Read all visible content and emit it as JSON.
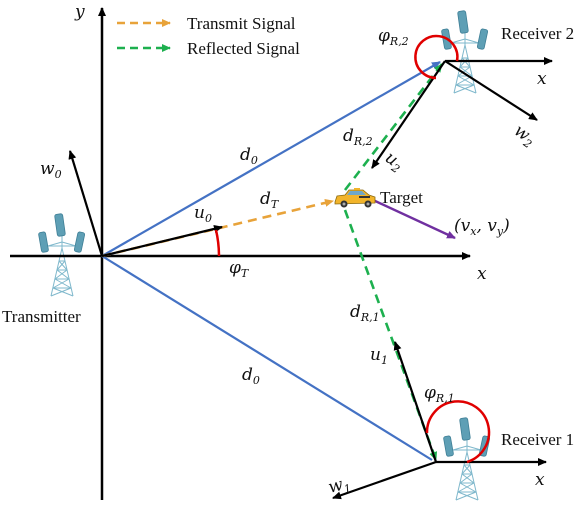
{
  "diagram": {
    "legend": [
      {
        "label": "Transmit Signal",
        "color": "#E8A33A",
        "style": "dashed-arrow"
      },
      {
        "label": "Reflected Signal",
        "color": "#1DB04F",
        "style": "dashed-arrow"
      }
    ],
    "colors": {
      "axis": "#000000",
      "baseline": "#4472C4",
      "transmit": "#E8A33A",
      "reflected": "#1DB04F",
      "velocity": "#7030A0",
      "angle": "#E00000",
      "tower": "#7FB8CC"
    },
    "nodes": {
      "transmitter": {
        "label": "Transmitter"
      },
      "receiver1": {
        "label": "Receiver 1"
      },
      "receiver2": {
        "label": "Receiver 2"
      },
      "target": {
        "label": "Target"
      }
    },
    "axis_labels": {
      "y": "y",
      "x_main": "x",
      "x_r1": "x",
      "x_r2": "x"
    },
    "math_labels": {
      "d0_top": {
        "base": "d",
        "sub": "0"
      },
      "d0_bottom": {
        "base": "d",
        "sub": "0"
      },
      "dT": {
        "base": "d",
        "sub": "T"
      },
      "dR2": {
        "base": "d",
        "sub": "R,2"
      },
      "dR1": {
        "base": "d",
        "sub": "R,1"
      },
      "u0": {
        "base": "u",
        "sub": "0"
      },
      "w0": {
        "base": "w",
        "sub": "0"
      },
      "u1": {
        "base": "u",
        "sub": "1"
      },
      "w1": {
        "base": "w",
        "sub": "1"
      },
      "u2": {
        "base": "u",
        "sub": "2"
      },
      "w2": {
        "base": "w",
        "sub": "2"
      },
      "phiT": {
        "base": "φ",
        "sub": "T"
      },
      "phiR1": {
        "base": "φ",
        "sub": "R,1"
      },
      "phiR2": {
        "base": "φ",
        "sub": "R,2"
      },
      "velocity": {
        "text": "(v",
        "sx": "x",
        "mid": ", v",
        "sy": "y",
        "end": ")"
      }
    }
  }
}
